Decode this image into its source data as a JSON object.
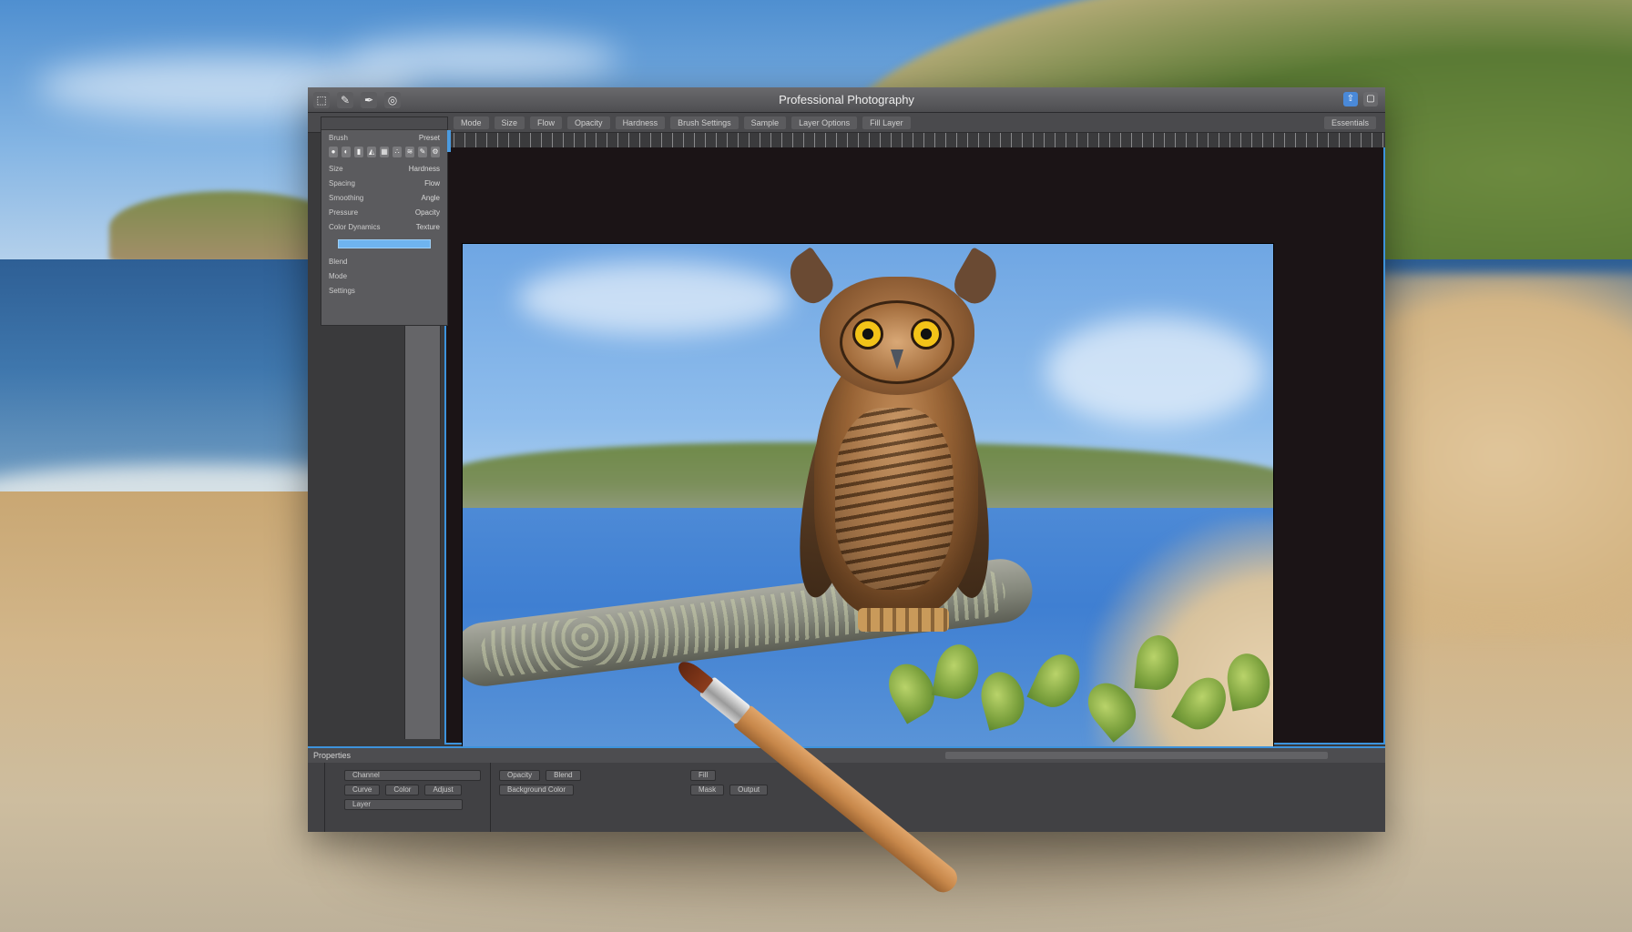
{
  "window": {
    "title": "Professional Photography"
  },
  "toolbar": {
    "icons": [
      "move-tool-icon",
      "brush-tool-icon",
      "pen-tool-icon",
      "clone-tool-icon"
    ],
    "right_icons": [
      "share-icon",
      "window-icon"
    ],
    "options": [
      "Mode",
      "Size",
      "Flow",
      "Opacity",
      "Hardness",
      "Brush Settings",
      "Sample",
      "Layer Options",
      "Fill Layer"
    ],
    "workspace": "Essentials"
  },
  "left_panel": {
    "rows": [
      {
        "label": "Brush",
        "value": "Preset"
      },
      {
        "label": "Size",
        "value": "Hardness"
      },
      {
        "label": "Spacing",
        "value": "Flow"
      },
      {
        "label": "Smoothing",
        "value": "Angle"
      },
      {
        "label": "Pressure",
        "value": "Opacity"
      },
      {
        "label": "Color Dynamics",
        "value": "Texture"
      },
      {
        "label": "Blend",
        "value": ""
      },
      {
        "label": "Mode",
        "value": ""
      },
      {
        "label": "Settings",
        "value": ""
      }
    ]
  },
  "timeline": {
    "label": "Properties"
  },
  "bottom_panel": {
    "fields": [
      "Channel",
      "Curve",
      "Color",
      "Adjust",
      "Layer",
      "Opacity",
      "Blend",
      "Background Color",
      "Fill",
      "Mask",
      "Output"
    ]
  },
  "colors": {
    "accent": "#3d93dc",
    "window_bg": "#3a3a3c",
    "canvas_bg": "#1b1416"
  }
}
